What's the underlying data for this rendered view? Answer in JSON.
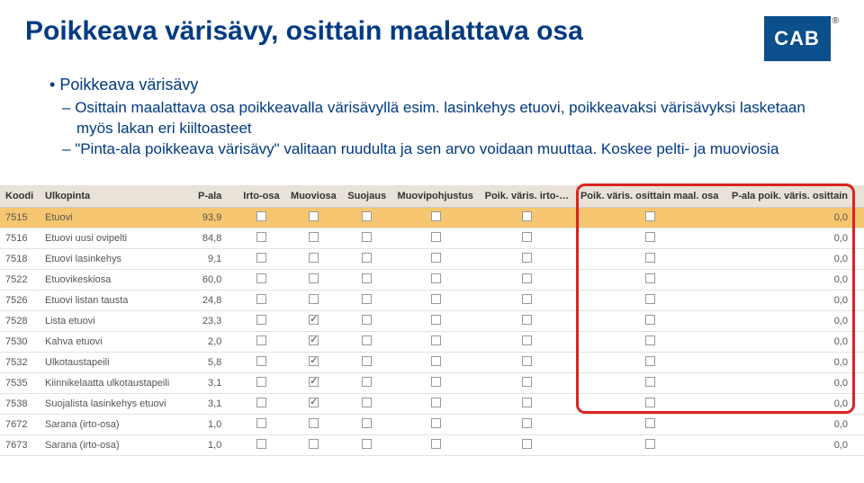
{
  "header": {
    "title": "Poikkeava värisävy, osittain maalattava osa",
    "logo_text": "CAB",
    "reg": "®"
  },
  "bullets": {
    "main": "Poikkeava värisävy",
    "sub1": "Osittain maalattava osa poikkeavalla värisävyllä esim. lasinkehys etuovi, poikkeavaksi värisävyksi lasketaan myös lakan eri kiiltoasteet",
    "sub2": "\"Pinta-ala poikkeava värisävy\" valitaan ruudulta ja sen arvo voidaan muuttaa. Koskee pelti- ja muoviosia"
  },
  "columns": {
    "koodi": "Koodi",
    "ulkopinta": "Ulkopinta",
    "pala": "P-ala",
    "irto": "Irto-osa",
    "muoviosa": "Muoviosa",
    "suojaus": "Suojaus",
    "muovip": "Muovipohjustus",
    "poik_irto": "Poik. väris. irto-…",
    "poik_osittain": "Poik. väris. osittain maal. osa",
    "p_ala_poik": "P-ala poik. väris. osittain"
  },
  "rows": [
    {
      "code": "7515",
      "name": "Etuovi",
      "pala": "93,9",
      "irto": false,
      "muoviosa": false,
      "suojaus": false,
      "muovip": false,
      "poik_irto": false,
      "poik_osit": false,
      "p_ala_poik": "0,0",
      "sel": true
    },
    {
      "code": "7516",
      "name": "Etuovi uusi ovipelti",
      "pala": "84,8",
      "irto": false,
      "muoviosa": false,
      "suojaus": false,
      "muovip": false,
      "poik_irto": false,
      "poik_osit": false,
      "p_ala_poik": "0,0"
    },
    {
      "code": "7518",
      "name": "Etuovi lasinkehys",
      "pala": "9,1",
      "irto": false,
      "muoviosa": false,
      "suojaus": false,
      "muovip": false,
      "poik_irto": false,
      "poik_osit": false,
      "p_ala_poik": "0,0"
    },
    {
      "code": "7522",
      "name": "Etuovikeskiosa",
      "pala": "60,0",
      "irto": false,
      "muoviosa": false,
      "suojaus": false,
      "muovip": false,
      "poik_irto": false,
      "poik_osit": false,
      "p_ala_poik": "0,0"
    },
    {
      "code": "7526",
      "name": "Etuovi listan tausta",
      "pala": "24,8",
      "irto": false,
      "muoviosa": false,
      "suojaus": false,
      "muovip": false,
      "poik_irto": false,
      "poik_osit": false,
      "p_ala_poik": "0,0"
    },
    {
      "code": "7528",
      "name": "Lista etuovi",
      "pala": "23,3",
      "irto": false,
      "muoviosa": true,
      "suojaus": false,
      "muovip": false,
      "poik_irto": false,
      "poik_osit": false,
      "p_ala_poik": "0,0"
    },
    {
      "code": "7530",
      "name": "Kahva etuovi",
      "pala": "2,0",
      "irto": false,
      "muoviosa": true,
      "suojaus": false,
      "muovip": false,
      "poik_irto": false,
      "poik_osit": false,
      "p_ala_poik": "0,0"
    },
    {
      "code": "7532",
      "name": "Ulkotaustapeili",
      "pala": "5,8",
      "irto": false,
      "muoviosa": true,
      "suojaus": false,
      "muovip": false,
      "poik_irto": false,
      "poik_osit": false,
      "p_ala_poik": "0,0"
    },
    {
      "code": "7535",
      "name": "Kiinnikelaatta ulkotaustapeili",
      "pala": "3,1",
      "irto": false,
      "muoviosa": true,
      "suojaus": false,
      "muovip": false,
      "poik_irto": false,
      "poik_osit": false,
      "p_ala_poik": "0,0"
    },
    {
      "code": "7538",
      "name": "Suojalista lasinkehys etuovi",
      "pala": "3,1",
      "irto": false,
      "muoviosa": true,
      "suojaus": false,
      "muovip": false,
      "poik_irto": false,
      "poik_osit": false,
      "p_ala_poik": "0,0"
    },
    {
      "code": "7672",
      "name": "Sarana (irto-osa)",
      "pala": "1,0",
      "irto": false,
      "muoviosa": false,
      "suojaus": false,
      "muovip": false,
      "poik_irto": false,
      "poik_osit": false,
      "p_ala_poik": "0,0"
    },
    {
      "code": "7673",
      "name": "Sarana (irto-osa)",
      "pala": "1,0",
      "irto": false,
      "muoviosa": false,
      "suojaus": false,
      "muovip": false,
      "poik_irto": false,
      "poik_osit": false,
      "p_ala_poik": "0,0"
    }
  ]
}
